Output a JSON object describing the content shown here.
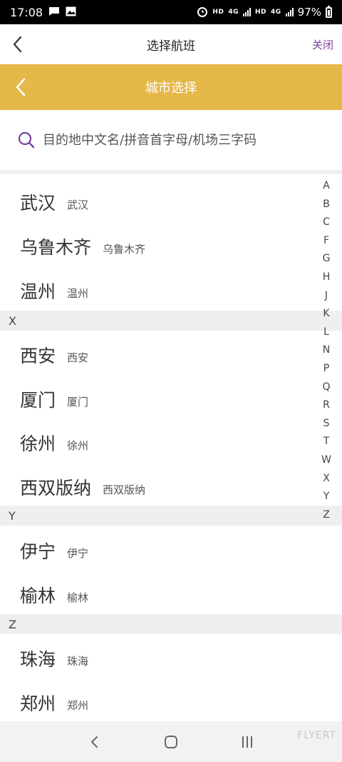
{
  "status_bar": {
    "time": "17:08",
    "battery": "97%",
    "hd1": "HD",
    "net1": "4G",
    "hd2": "HD",
    "net2": "4G",
    "left_icons": [
      "message-icon",
      "image-icon"
    ],
    "right_icons": [
      "alarm-icon",
      "signal-icon",
      "battery-icon"
    ]
  },
  "header": {
    "title": "选择航班",
    "close_label": "关闭",
    "accent_color": "#7b3fa0"
  },
  "subheader": {
    "title": "城市选择",
    "background_color": "#e5b84a"
  },
  "search": {
    "placeholder": "目的地中文名/拼音首字母/机场三字码",
    "value": ""
  },
  "list": {
    "rows": [
      {
        "big": "武汉",
        "small": "武汉"
      },
      {
        "big": "乌鲁木齐",
        "small": "乌鲁木齐"
      },
      {
        "big": "温州",
        "small": "温州"
      },
      {
        "section": "X"
      },
      {
        "big": "西安",
        "small": "西安"
      },
      {
        "big": "厦门",
        "small": "厦门"
      },
      {
        "big": "徐州",
        "small": "徐州"
      },
      {
        "big": "西双版纳",
        "small": "西双版纳"
      },
      {
        "section": "Y"
      },
      {
        "big": "伊宁",
        "small": "伊宁"
      },
      {
        "big": "榆林",
        "small": "榆林"
      },
      {
        "section": "Z"
      },
      {
        "big": "珠海",
        "small": "珠海"
      },
      {
        "big": "郑州",
        "small": "郑州"
      }
    ]
  },
  "index_letters": [
    "A",
    "B",
    "C",
    "F",
    "G",
    "H",
    "J",
    "K",
    "L",
    "N",
    "P",
    "Q",
    "R",
    "S",
    "T",
    "W",
    "X",
    "Y",
    "Z"
  ],
  "watermark": "FLYERT"
}
